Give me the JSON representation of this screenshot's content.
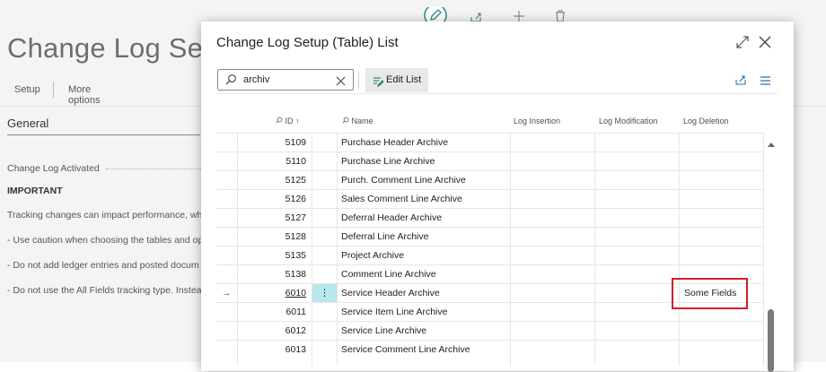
{
  "background": {
    "page_title": "Change Log Setu",
    "tabs": [
      "Setup",
      "More options"
    ],
    "section_title": "General",
    "field_label": "Change Log Activated",
    "important_label": "IMPORTANT",
    "lines": [
      "Tracking changes can impact performance, whi",
      "- Use caution when choosing the tables and op",
      "- Do not add ledger entries and posted docum",
      "- Do not use the All Fields tracking type. Instea"
    ]
  },
  "dialog": {
    "title": "Change Log Setup (Table) List",
    "search_value": "archiv",
    "edit_list_label": "Edit List",
    "columns": {
      "id": "ID",
      "id_sort": "↑",
      "name": "Name",
      "log_insertion": "Log Insertion",
      "log_modification": "Log Modification",
      "log_deletion": "Log Deletion"
    },
    "rows": [
      {
        "id": "5109",
        "name": "Purchase Header Archive",
        "ins": "",
        "mod": "",
        "del": ""
      },
      {
        "id": "5110",
        "name": "Purchase Line Archive",
        "ins": "",
        "mod": "",
        "del": ""
      },
      {
        "id": "5125",
        "name": "Purch. Comment Line Archive",
        "ins": "",
        "mod": "",
        "del": ""
      },
      {
        "id": "5126",
        "name": "Sales Comment Line Archive",
        "ins": "",
        "mod": "",
        "del": ""
      },
      {
        "id": "5127",
        "name": "Deferral Header Archive",
        "ins": "",
        "mod": "",
        "del": ""
      },
      {
        "id": "5128",
        "name": "Deferral Line Archive",
        "ins": "",
        "mod": "",
        "del": ""
      },
      {
        "id": "5135",
        "name": "Project Archive",
        "ins": "",
        "mod": "",
        "del": ""
      },
      {
        "id": "5138",
        "name": "Comment Line Archive",
        "ins": "",
        "mod": "",
        "del": ""
      },
      {
        "id": "6010",
        "name": "Service Header Archive",
        "ins": "",
        "mod": "",
        "del": "Some Fields",
        "selected": true
      },
      {
        "id": "6011",
        "name": "Service Item Line Archive",
        "ins": "",
        "mod": "",
        "del": ""
      },
      {
        "id": "6012",
        "name": "Service Line Archive",
        "ins": "",
        "mod": "",
        "del": ""
      },
      {
        "id": "6013",
        "name": "Service Comment Line Archive",
        "ins": "",
        "mod": "",
        "del": ""
      }
    ],
    "row_arrow": "→",
    "row_menu": "⋮"
  },
  "colors": {
    "accent": "#0f6b5e",
    "selected_cell": "#b7e8ec",
    "highlight_box": "#d01f24"
  }
}
